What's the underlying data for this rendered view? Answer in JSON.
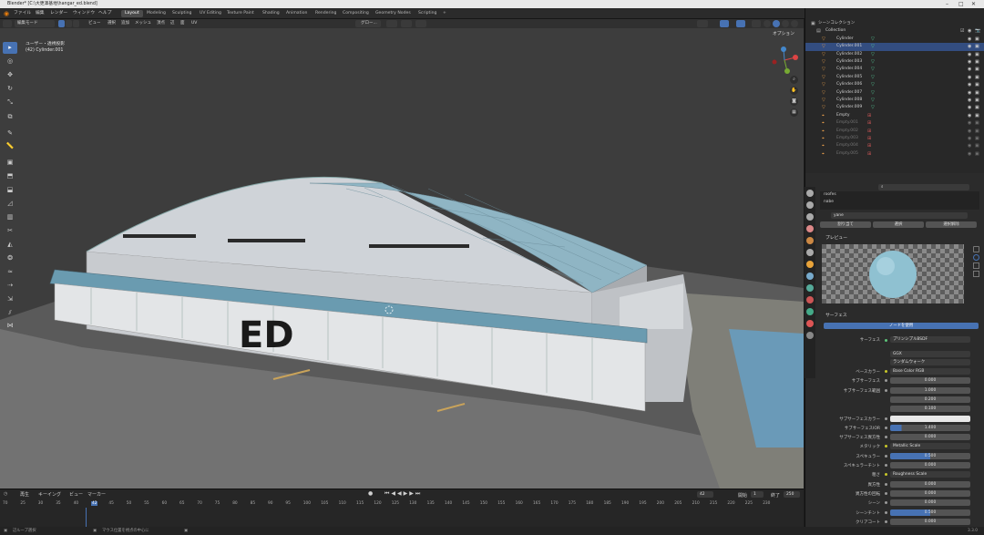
{
  "title_bar": {
    "text": "Blender* [C:\\大更澤基地\\hangar_ed.blend]"
  },
  "menu": [
    "ファイル",
    "編集",
    "レンダー",
    "ウィンドウ",
    "ヘルプ"
  ],
  "workspaces": [
    "Layout",
    "Modeling",
    "Sculpting",
    "UV Editing",
    "Texture Paint",
    "Shading",
    "Animation",
    "Rendering",
    "Compositing",
    "Geometry Nodes",
    "Scripting",
    "+"
  ],
  "active_workspace": "Layout",
  "scene": "Scene",
  "view_layer": "ViewLayer",
  "viewport_header": {
    "mode": "編集モード",
    "menus": [
      "ビュー",
      "選択",
      "追加",
      "メッシュ",
      "頂点",
      "辺",
      "面",
      "UV"
    ],
    "orientation": "グロー...",
    "options": "オプション"
  },
  "viewport_overlay": {
    "view_name": "ユーザー・透視投影",
    "object_info": "(42) Cylinder.001"
  },
  "building_sign": "ED",
  "tools": [
    "select",
    "cursor",
    "move",
    "rotate",
    "scale",
    "transform",
    "annotate",
    "measure",
    "add-cube",
    "extrude",
    "inset",
    "bevel",
    "loop-cut",
    "knife",
    "poly-build",
    "spin",
    "smooth",
    "edge-slide",
    "shrink",
    "shear",
    "rip"
  ],
  "outliner": {
    "root": "シーンコレクション",
    "collection": "Collection",
    "items": [
      {
        "name": "Cylinder",
        "selected": false,
        "dim": false
      },
      {
        "name": "Cylinder.001",
        "selected": true,
        "dim": false
      },
      {
        "name": "Cylinder.002",
        "selected": false,
        "dim": false
      },
      {
        "name": "Cylinder.003",
        "selected": false,
        "dim": false
      },
      {
        "name": "Cylinder.004",
        "selected": false,
        "dim": false
      },
      {
        "name": "Cylinder.005",
        "selected": false,
        "dim": false
      },
      {
        "name": "Cylinder.006",
        "selected": false,
        "dim": false
      },
      {
        "name": "Cylinder.007",
        "selected": false,
        "dim": false
      },
      {
        "name": "Cylinder.008",
        "selected": false,
        "dim": false
      },
      {
        "name": "Cylinder.009",
        "selected": false,
        "dim": false
      },
      {
        "name": "Empty",
        "selected": false,
        "dim": false
      },
      {
        "name": "Empty.001",
        "selected": false,
        "dim": true
      },
      {
        "name": "Empty.002",
        "selected": false,
        "dim": true
      },
      {
        "name": "Empty.003",
        "selected": false,
        "dim": true
      },
      {
        "name": "Empty.004",
        "selected": false,
        "dim": true
      },
      {
        "name": "Empty.005",
        "selected": false,
        "dim": true
      }
    ]
  },
  "properties": {
    "material_slots": [
      "roofes",
      "nabe"
    ],
    "material_name": "yane",
    "buttons": [
      "割り当て",
      "選択",
      "選択解除"
    ],
    "preview_label": "プレビュー",
    "surface_label": "サーフェス",
    "use_nodes": "ノードを使用",
    "surface_shader_label": "サーフェス",
    "surface_shader": "プリンシプルBSDF",
    "distribution": "GGX",
    "subsurface_method": "ランダムウォーク",
    "rows": [
      {
        "label": "ベースカラー",
        "value": "Base Color RGB",
        "kind": "link"
      },
      {
        "label": "サブサーフェス",
        "value": "0.000",
        "kind": "num"
      },
      {
        "label": "サブサーフェス範囲",
        "value": "1.000",
        "kind": "num"
      },
      {
        "label": "",
        "value": "0.200",
        "kind": "num"
      },
      {
        "label": "",
        "value": "0.100",
        "kind": "num"
      },
      {
        "label": "サブサーフェスカラー",
        "value": "",
        "kind": "color"
      },
      {
        "label": "サブサーフェスIOR",
        "value": "1.400",
        "kind": "num"
      },
      {
        "label": "サブサーフェス異方性",
        "value": "0.000",
        "kind": "num"
      },
      {
        "label": "メタリック",
        "value": "Metallic Scale",
        "kind": "link"
      },
      {
        "label": "スペキュラー",
        "value": "0.500",
        "kind": "slider"
      },
      {
        "label": "スペキュラーチント",
        "value": "0.000",
        "kind": "num"
      },
      {
        "label": "粗さ",
        "value": "Roughness Scale",
        "kind": "link"
      },
      {
        "label": "異方性",
        "value": "0.000",
        "kind": "num"
      },
      {
        "label": "異方性の回転",
        "value": "0.000",
        "kind": "num"
      },
      {
        "label": "シーン",
        "value": "0.000",
        "kind": "num"
      },
      {
        "label": "シーンチント",
        "value": "0.500",
        "kind": "slider"
      },
      {
        "label": "クリアコート",
        "value": "0.000",
        "kind": "num"
      }
    ]
  },
  "timeline": {
    "menus": [
      "再生",
      "キーイング",
      "ビュー",
      "マーカー"
    ],
    "current_frame": "42",
    "start_label": "開始",
    "start": "1",
    "end_label": "終了",
    "end": "250",
    "ticks": [
      "70",
      "25",
      "30",
      "35",
      "40",
      "42",
      "45",
      "50",
      "55",
      "60",
      "65",
      "70",
      "75",
      "80",
      "85",
      "90",
      "95",
      "100",
      "105",
      "110",
      "115",
      "120",
      "125",
      "130",
      "135",
      "140",
      "145",
      "150",
      "155",
      "160",
      "165",
      "170",
      "175",
      "180",
      "185",
      "190",
      "195",
      "200",
      "205",
      "210",
      "215",
      "220",
      "225",
      "230"
    ]
  },
  "status_bar": {
    "left": "辺ループ選択",
    "middle": "マウス位置を視点の中心に",
    "version": "3.3.0"
  }
}
